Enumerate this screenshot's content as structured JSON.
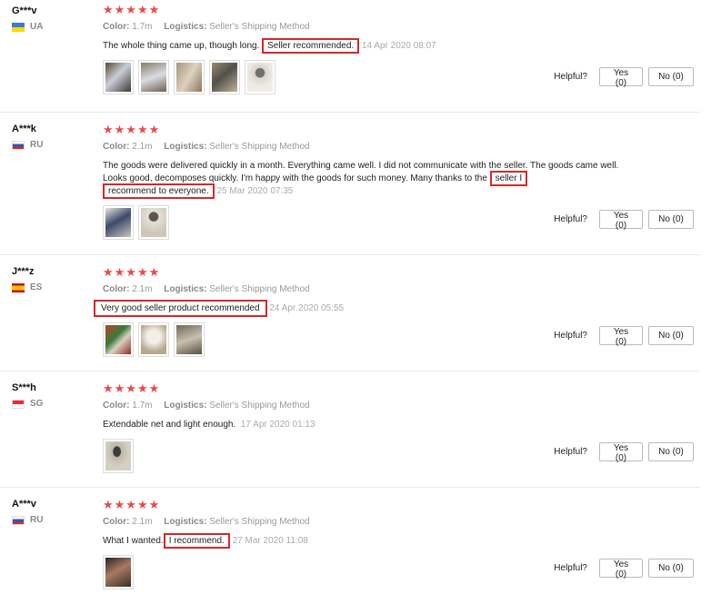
{
  "labels": {
    "color": "Color:",
    "logistics": "Logistics:",
    "helpful": "Helpful?"
  },
  "stars": "★★★★★",
  "reviews": [
    {
      "user": "G***v",
      "country": "UA",
      "color": "1.7m",
      "logistics": "Seller's Shipping Method",
      "text_before": "The whole thing came up, though long.",
      "highlight": "Seller recommended.",
      "text_after": "",
      "date": "14 Apr 2020 08:07",
      "yes": "Yes (0)",
      "no": "No (0)"
    },
    {
      "user": "A***k",
      "country": "RU",
      "color": "2.1m",
      "logistics": "Seller's Shipping Method",
      "text_before": "The goods were delivered quickly in a month. Everything came well. I did not communicate with the seller. The goods came well. Looks good, decomposes quickly. I'm happy with the goods for such money. Many thanks to the",
      "highlight": "seller I",
      "highlight2": "recommend to everyone.",
      "text_after": "",
      "date": "25 Mar 2020 07:35",
      "yes": "Yes (0)",
      "no": "No (0)"
    },
    {
      "user": "J***z",
      "country": "ES",
      "color": "2.1m",
      "logistics": "Seller's Shipping Method",
      "text_before": "",
      "highlight": "Very good seller product recommended",
      "text_after": "",
      "date": "24 Apr 2020 05:55",
      "yes": "Yes (0)",
      "no": "No (0)"
    },
    {
      "user": "S***h",
      "country": "SG",
      "color": "1.7m",
      "logistics": "Seller's Shipping Method",
      "text_before": "Extendable net and light enough.",
      "highlight": "",
      "text_after": "",
      "date": "17 Apr 2020 01:13",
      "yes": "Yes (0)",
      "no": "No (0)"
    },
    {
      "user": "A***v",
      "country": "RU",
      "color": "2.1m",
      "logistics": "Seller's Shipping Method",
      "text_before": "What I wanted.",
      "highlight": "I recommend.",
      "text_after": "",
      "date": "27 Mar 2020 11:08",
      "yes": "Yes (0)",
      "no": "No (0)"
    }
  ]
}
